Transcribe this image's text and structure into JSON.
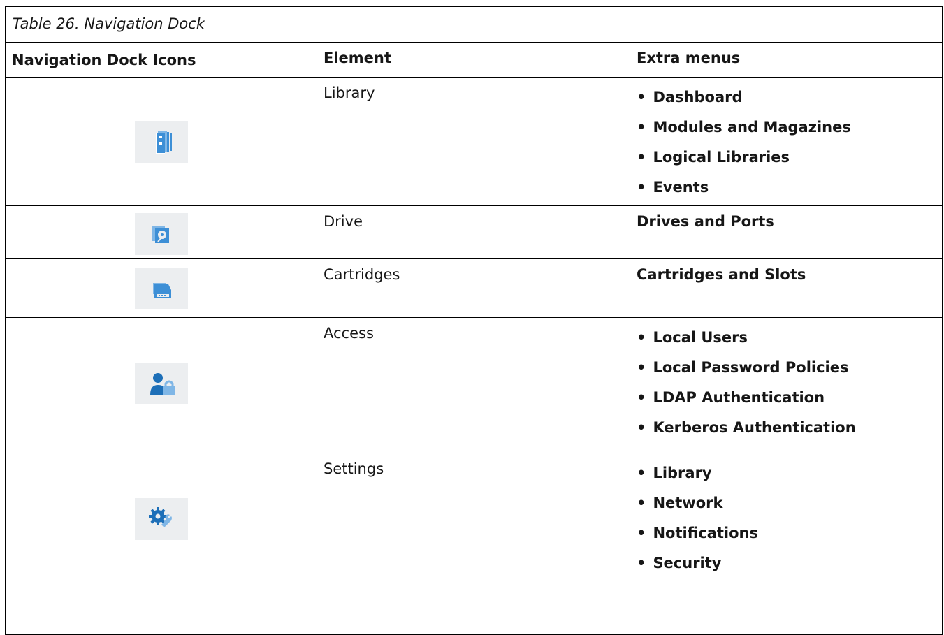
{
  "caption": "Table 26. Navigation Dock",
  "headers": [
    "Navigation Dock Icons",
    "Element",
    "Extra menus"
  ],
  "rows": [
    {
      "icon": "library-icon",
      "element": "Library",
      "menus": [
        "Dashboard",
        "Modules and Magazines",
        "Logical Libraries",
        "Events"
      ]
    },
    {
      "icon": "drive-icon",
      "element": "Drive",
      "menus_plain": "Drives and Ports"
    },
    {
      "icon": "cartridges-icon",
      "element": "Cartridges",
      "menus_plain": "Cartridges and Slots"
    },
    {
      "icon": "access-icon",
      "element": "Access",
      "menus": [
        "Local Users",
        "Local Password Policies",
        "LDAP Authentication",
        "Kerberos Authentication"
      ]
    },
    {
      "icon": "settings-icon",
      "element": "Settings",
      "menus": [
        "Library",
        "Network",
        "Notifications",
        "Security"
      ]
    }
  ],
  "colors": {
    "icon_blue": "#3d8fd6",
    "icon_bg": "#eceef0"
  }
}
